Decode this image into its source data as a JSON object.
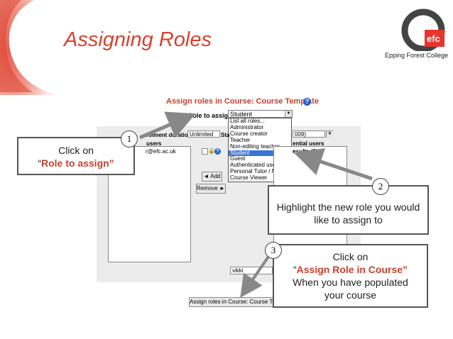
{
  "slide": {
    "title": "Assigning Roles",
    "brand_caption": "Epping Forest College",
    "logo_text": "efc"
  },
  "moodle": {
    "heading": "Assign roles in Course: Course Template",
    "help_glyph": "?",
    "role_to_assign_label": "Role to assign",
    "role_select_value": "Student",
    "role_options": [
      "List all roles...",
      "Administrator",
      "Course creator",
      "Teacher",
      "Non-editing teacher",
      "Student",
      "Guest",
      "Authenticated user",
      "Personal Tutor / Mentor",
      "Course Viewer"
    ],
    "selected_role_index": 5,
    "enrolment_duration_label": "rolment duration",
    "enrolment_duration_value": "Unlimited",
    "start_label": "Sta",
    "start_value": "009)",
    "existing_users_label": "users",
    "existing_user_email": "r@efc.ac.uk",
    "potential_users_label": "ential users",
    "results_label": "esults (0)",
    "add_button": "◄ Add",
    "remove_button": "Remove ►",
    "search_value": "vikki",
    "submit_button": "Assign roles in Course: Course Te"
  },
  "callouts": {
    "one": {
      "number": "1",
      "line1": "Click on",
      "quote_open": "“",
      "emph": "Role to assign”"
    },
    "two": {
      "number": "2",
      "text": "Highlight the new role you would like to assign to"
    },
    "three": {
      "number": "3",
      "line1": "Click on",
      "quote_open": "“",
      "emph": "Assign Role in Course”",
      "line3": "When you have populated",
      "line4": "your course"
    }
  },
  "colors": {
    "accent_red": "#d9412f",
    "brand_red": "#e8352b",
    "arrow_gray": "#888888",
    "highlight_blue": "#3875d7"
  }
}
